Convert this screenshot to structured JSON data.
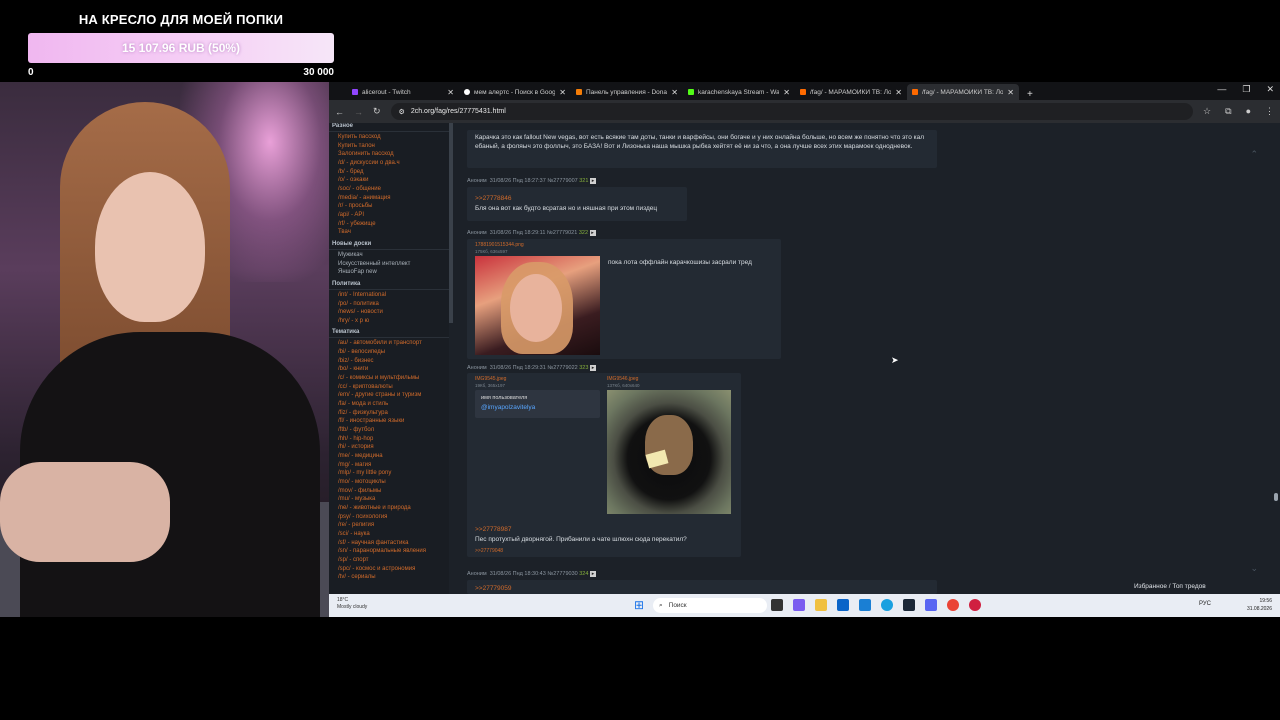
{
  "donation": {
    "title": "НА КРЕСЛО ДЛЯ МОЕЙ ПОПКИ",
    "amount": "15 107.96 RUB (50%)",
    "progress": 0.5,
    "min": "0",
    "max": "30 000"
  },
  "browser": {
    "tabs": [
      {
        "label": "alicerout - Twitch",
        "color": "#9146ff"
      },
      {
        "label": "мем алертс - Поиск в Google",
        "color": "#ffffff"
      },
      {
        "label": "Панель управления - Donatio",
        "color": "#f57d07"
      },
      {
        "label": "karachenskaya Stream - Watch",
        "color": "#53fc18"
      },
      {
        "label": "/fag/ - МАРАМОЙКИ ТВ: Лоп",
        "color": "#ff6a00"
      },
      {
        "label": "/fag/ - МАРАМОЙКИ ТВ: Лоп",
        "color": "#ff6a00",
        "active": true
      }
    ],
    "url": "2ch.org/fag/res/27775431.html"
  },
  "sidebar": {
    "top_label": "Разное",
    "top_items": [
      "Купить пасскод",
      "Купить талон",
      "Залогинить пасскод",
      "/d/ - дискуссии о два.ч",
      "/b/ - бред",
      "/o/ - оэкаки",
      "/soc/ - общение",
      "/media/ - анимация",
      "/r/ - просьбы",
      "/api/ - API",
      "/rf/ - убежище",
      "Твач"
    ],
    "new_label": "Новые доски",
    "new_items": [
      "Мужикач",
      "Искусственный интеллект",
      "ЯншоFap new"
    ],
    "politics_label": "Политика",
    "politics_items": [
      "/int/ - International",
      "/po/ - политика",
      "/news/ - новости",
      "/hry/ - х р ю"
    ],
    "topics_label": "Тематика",
    "topics_items": [
      "/au/ - автомобили и транспорт",
      "/bi/ - велосипеды",
      "/biz/ - бизнес",
      "/bo/ - книги",
      "/c/ - комиксы и мультфильмы",
      "/cc/ - криптовалюты",
      "/em/ - другие страны и туризм",
      "/fa/ - мода и стиль",
      "/fiz/ - физкультура",
      "/fl/ - иностранные языки",
      "/ftb/ - футбол",
      "/hh/ - hip-hop",
      "/hi/ - история",
      "/me/ - медицина",
      "/mg/ - магия",
      "/mlp/ - my little pony",
      "/mo/ - мотоциклы",
      "/mov/ - фильмы",
      "/mu/ - музыка",
      "/ne/ - животные и природа",
      "/psy/ - психология",
      "/re/ - религия",
      "/sci/ - наука",
      "/sf/ - научная фантастика",
      "/sn/ - паранормальные явления",
      "/sp/ - спорт",
      "/spc/ - космос и астрономия",
      "/tv/ - сериалы"
    ]
  },
  "posts": {
    "p0_text": "Карачка это как fallout New vegas, вот есть всякие там доты, танки и варфейсы, они богаче и у них онлайна больше, но всем же понятно что это кал ебаный, а фоляыч это фоллыч, это БАЗА! Вот и Лизонька наша мышка рыбка хейтят её ни за что, а она лучше всех этих марамоек однодневок.",
    "p1_meta_name": "Аноним",
    "p1_meta_date": "31/08/26 Пнд 18:27:37",
    "p1_meta_no": "№27779007",
    "p1_meta_idx": "321",
    "p1_reply": ">>27778846",
    "p1_text": "Бля она вот как будто всратая но и няшная при этом пиздец",
    "p2_meta_name": "Аноним",
    "p2_meta_date": "31/08/26 Пнд 18:29:11",
    "p2_meta_no": "№27779021",
    "p2_meta_idx": "322",
    "p2_fname": "17881901515344.png",
    "p2_finfo": "175Кб, 636x597",
    "p2_text": "пока лота оффлайн карачкошизы засрали тред",
    "p3_meta_name": "Аноним",
    "p3_meta_date": "31/08/26 Пнд 18:29:31",
    "p3_meta_no": "№27779022",
    "p3_meta_idx": "323",
    "p3_f1name": "IMG9545.jpeg",
    "p3_f1info": "19Кб, 365x197",
    "p3_f2name": "IMG9546.jpeg",
    "p3_f2info": "137Кб, 640x640",
    "p3_card_user": "имя пользователя",
    "p3_card_handle": "@imyapolzavitelya",
    "p3_reply": ">>27778987",
    "p3_text": "Пес протухтый дворнягой. Прибанили а чате шлюхн сюда перекатил?",
    "p3_backlink": ">>27779048",
    "p4_meta_name": "Аноним",
    "p4_meta_date": "31/08/26 Пнд 18:30:43",
    "p4_meta_no": "№27779030",
    "p4_meta_idx": "324",
    "p4_reply": ">>27779059"
  },
  "page_footer": {
    "fav": "Избранное / Топ тредов"
  },
  "taskbar": {
    "weather_temp": "18°C",
    "weather_desc": "Mostly cloudy",
    "search_label": "Поиск",
    "lang": "РУС",
    "time": "19:56",
    "date": "31.08.2026"
  }
}
